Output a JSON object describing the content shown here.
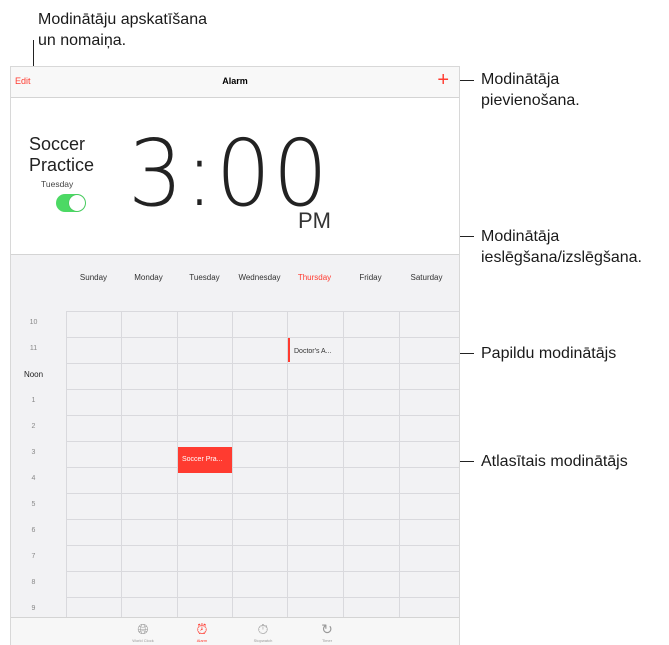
{
  "callouts": {
    "edit": [
      "Modinātāju apskatīšana",
      "un nomaiņa."
    ],
    "add": [
      "Modinātāja",
      "pievienošana."
    ],
    "toggle": [
      "Modinātāja",
      "ieslēgšana/izslēgšana."
    ],
    "additional": "Papildu modinātājs",
    "selected": "Atlasītais modinātājs"
  },
  "navbar": {
    "edit_label": "Edit",
    "title": "Alarm",
    "add_icon": "plus-icon"
  },
  "alarm": {
    "label": "Soccer Practice",
    "day": "Tuesday",
    "time": "3:00",
    "period": "PM",
    "enabled": true
  },
  "calendar": {
    "days": [
      "Sunday",
      "Monday",
      "Tuesday",
      "Wednesday",
      "Thursday",
      "Friday",
      "Saturday"
    ],
    "today": "Thursday",
    "hours": [
      "10",
      "11",
      "Noon",
      "1",
      "2",
      "3",
      "4",
      "5",
      "6",
      "7",
      "8",
      "9"
    ],
    "events": {
      "doctor": "Doctor's A...",
      "soccer": "Soccer Pra..."
    }
  },
  "tabs": [
    {
      "label": "World Clock",
      "icon": "globe-icon"
    },
    {
      "label": "Alarm",
      "icon": "alarm-clock-icon"
    },
    {
      "label": "Stopwatch",
      "icon": "stopwatch-icon"
    },
    {
      "label": "Timer",
      "icon": "timer-icon"
    }
  ],
  "colors": {
    "accent": "#ff3b30",
    "toggle_on": "#4cd964"
  }
}
